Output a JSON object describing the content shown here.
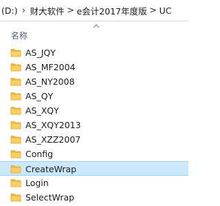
{
  "address": {
    "drive": "(D:)",
    "path": [
      "财大软件",
      "e会计2017年度版",
      "UC"
    ],
    "separator": ">",
    "head_separator": "›"
  },
  "columns": {
    "name": "名称"
  },
  "items": [
    {
      "label": "AS_JQY",
      "type": "folder",
      "selected": false
    },
    {
      "label": "AS_MF2004",
      "type": "folder",
      "selected": false
    },
    {
      "label": "AS_NY2008",
      "type": "folder",
      "selected": false
    },
    {
      "label": "AS_QY",
      "type": "folder",
      "selected": false
    },
    {
      "label": "AS_XQY",
      "type": "folder",
      "selected": false
    },
    {
      "label": "AS_XQY2013",
      "type": "folder",
      "selected": false
    },
    {
      "label": "AS_XZZ2007",
      "type": "folder",
      "selected": false
    },
    {
      "label": "Config",
      "type": "folder",
      "selected": false
    },
    {
      "label": "CreateWrap",
      "type": "folder",
      "selected": true
    },
    {
      "label": "Login",
      "type": "folder",
      "selected": false
    },
    {
      "label": "SelectWrap",
      "type": "folder",
      "selected": false
    }
  ],
  "colors": {
    "folder_body": "#f7cf62",
    "folder_edge": "#e2ac2f",
    "folder_back": "#ebb84a",
    "selection_bg": "#cce8ff",
    "selection_border": "#99d1ff",
    "header_text": "#4c607a"
  },
  "icons": {
    "folder": "folder-icon",
    "sort": "chevron-up-icon"
  }
}
